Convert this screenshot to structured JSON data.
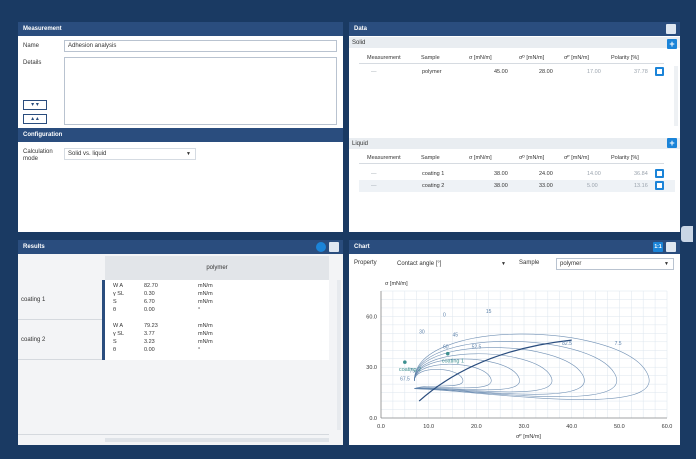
{
  "measurement": {
    "header": "Measurement",
    "name_label": "Name",
    "name_value": "Adhesion analysis",
    "details_label": "Details",
    "configuration_header": "Configuration",
    "calc_mode_label_1": "Calculation",
    "calc_mode_label_2": "mode",
    "calc_mode_value": "Solid vs. liquid"
  },
  "data": {
    "header": "Data",
    "solid_label": "Solid",
    "liquid_label": "Liquid",
    "columns": [
      "Measurement",
      "Sample",
      "σ [mN/m]",
      "σᴰ [mN/m]",
      "σᴾ [mN/m]",
      "Polarity [%]"
    ],
    "solid_rows": [
      {
        "measurement": "—",
        "sample": "polymer",
        "sigma": "45.00",
        "sigma_d": "28.00",
        "sigma_p": "17.00",
        "polarity": "37.78"
      }
    ],
    "liquid_rows": [
      {
        "measurement": "—",
        "sample": "coating 1",
        "sigma": "38.00",
        "sigma_d": "24.00",
        "sigma_p": "14.00",
        "polarity": "36.84"
      },
      {
        "measurement": "—",
        "sample": "coating 2",
        "sigma": "38.00",
        "sigma_d": "33.00",
        "sigma_p": "5.00",
        "polarity": "13.16"
      }
    ]
  },
  "results": {
    "header": "Results",
    "column": "polymer",
    "rows": [
      {
        "label": "coating 1",
        "symbols": [
          "W A",
          "γ SL",
          "S",
          "θ"
        ],
        "values": [
          "82.70",
          "0.30",
          "6.70",
          "0.00"
        ],
        "units": [
          "mN/m",
          "mN/m",
          "mN/m",
          "°"
        ]
      },
      {
        "label": "coating 2",
        "symbols": [
          "W A",
          "γ SL",
          "S",
          "θ"
        ],
        "values": [
          "79.23",
          "3.77",
          "3.23",
          "0.00"
        ],
        "units": [
          "mN/m",
          "mN/m",
          "mN/m",
          "°"
        ]
      }
    ]
  },
  "chart": {
    "header": "Chart",
    "property_label": "Property",
    "property_value": "Contact angle [°]",
    "sample_label": "Sample",
    "sample_value": "polymer",
    "badge": "1:1"
  },
  "chart_data": {
    "type": "scatter",
    "ylabel": "σ  [mN/m]",
    "xlabel": "σᴾ  [mN/m]",
    "xlim": [
      0,
      60
    ],
    "ylim": [
      0,
      75
    ],
    "x_ticks": [
      "0.0",
      "10.0",
      "20.0",
      "30.0",
      "40.0",
      "50.0",
      "60.0"
    ],
    "y_ticks": [
      "0.0",
      "30.0",
      "60.0"
    ],
    "points": [
      {
        "name": "coating 1",
        "x": 14,
        "y": 38
      },
      {
        "name": "coating 2",
        "x": 5,
        "y": 33
      }
    ],
    "contour_labels": [
      "0",
      "15",
      "30",
      "45",
      "60",
      "67.5",
      "75",
      "82.5",
      "7.5",
      "52.5"
    ],
    "colors": {
      "contour": "#5a7fa8",
      "point": "#3c8f8f",
      "grid": "#dde6ee"
    }
  }
}
